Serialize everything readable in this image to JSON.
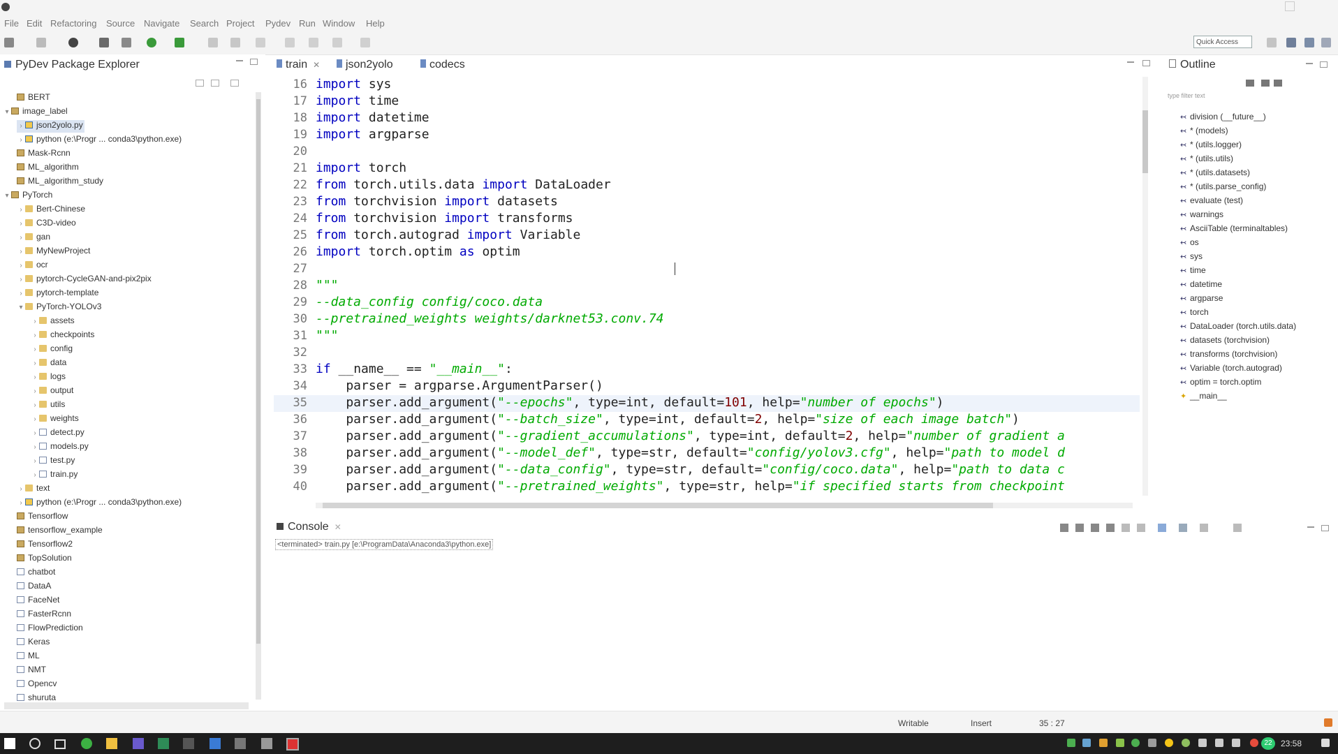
{
  "window": {
    "title": ""
  },
  "menu": [
    "File",
    "Edit",
    "Refactoring",
    "Source",
    "Navigate",
    "Search",
    "Project",
    "Pydev",
    "Run",
    "Window",
    "Help"
  ],
  "toolbar": {
    "quick_access": "Quick Access"
  },
  "explorer": {
    "title": "PyDev Package Explorer",
    "items": [
      {
        "label": "BERT"
      },
      {
        "label": "image_label"
      },
      {
        "label": "json2yolo.py"
      },
      {
        "label": "python (e:\\Progr ... conda3\\python.exe)"
      },
      {
        "label": "Mask-Rcnn"
      },
      {
        "label": "ML_algorithm"
      },
      {
        "label": "ML_algorithm_study"
      },
      {
        "label": "PyTorch"
      },
      {
        "label": "Bert-Chinese"
      },
      {
        "label": "C3D-video"
      },
      {
        "label": "gan"
      },
      {
        "label": "MyNewProject"
      },
      {
        "label": "ocr"
      },
      {
        "label": "pytorch-CycleGAN-and-pix2pix"
      },
      {
        "label": "pytorch-template"
      },
      {
        "label": "PyTorch-YOLOv3"
      },
      {
        "label": "assets"
      },
      {
        "label": "checkpoints"
      },
      {
        "label": "config"
      },
      {
        "label": "data"
      },
      {
        "label": "logs"
      },
      {
        "label": "output"
      },
      {
        "label": "utils"
      },
      {
        "label": "weights"
      },
      {
        "label": "detect.py"
      },
      {
        "label": "models.py"
      },
      {
        "label": "test.py"
      },
      {
        "label": "train.py"
      },
      {
        "label": "text"
      },
      {
        "label": "python (e:\\Progr ... conda3\\python.exe)"
      },
      {
        "label": "Tensorflow"
      },
      {
        "label": "tensorflow_example"
      },
      {
        "label": "Tensorflow2"
      },
      {
        "label": "TopSolution"
      },
      {
        "label": "chatbot"
      },
      {
        "label": "DataA"
      },
      {
        "label": "FaceNet"
      },
      {
        "label": "FasterRcnn"
      },
      {
        "label": "FlowPrediction"
      },
      {
        "label": "Keras"
      },
      {
        "label": "ML"
      },
      {
        "label": "NMT"
      },
      {
        "label": "Opencv"
      },
      {
        "label": "shuruta"
      }
    ]
  },
  "editor": {
    "tabs": [
      "train",
      "json2yolo",
      "codecs"
    ],
    "lines": [
      {
        "n": "16",
        "t": "import sys"
      },
      {
        "n": "17",
        "t": "import time"
      },
      {
        "n": "18",
        "t": "import datetime"
      },
      {
        "n": "19",
        "t": "import argparse"
      },
      {
        "n": "20",
        "t": ""
      },
      {
        "n": "21",
        "t": "import torch"
      },
      {
        "n": "22",
        "t": "from torch.utils.data import DataLoader"
      },
      {
        "n": "23",
        "t": "from torchvision import datasets"
      },
      {
        "n": "24",
        "t": "from torchvision import transforms"
      },
      {
        "n": "25",
        "t": "from torch.autograd import Variable"
      },
      {
        "n": "26",
        "t": "import torch.optim as optim"
      },
      {
        "n": "27",
        "t": ""
      },
      {
        "n": "28",
        "t": "\"\"\""
      },
      {
        "n": "29",
        "t": "--data_config config/coco.data"
      },
      {
        "n": "30",
        "t": "--pretrained_weights weights/darknet53.conv.74"
      },
      {
        "n": "31",
        "t": "\"\"\""
      },
      {
        "n": "32",
        "t": ""
      },
      {
        "n": "33",
        "t": "if __name__ == \"__main__\":"
      },
      {
        "n": "34",
        "t": "    parser = argparse.ArgumentParser()"
      },
      {
        "n": "35",
        "t": "    parser.add_argument(\"--epochs\", type=int, default=101, help=\"number of epochs\")"
      },
      {
        "n": "36",
        "t": "    parser.add_argument(\"--batch_size\", type=int, default=2, help=\"size of each image batch\")"
      },
      {
        "n": "37",
        "t": "    parser.add_argument(\"--gradient_accumulations\", type=int, default=2, help=\"number of gradient a"
      },
      {
        "n": "38",
        "t": "    parser.add_argument(\"--model_def\", type=str, default=\"config/yolov3.cfg\", help=\"path to model d"
      },
      {
        "n": "39",
        "t": "    parser.add_argument(\"--data_config\", type=str, default=\"config/coco.data\", help=\"path to data c"
      },
      {
        "n": "40",
        "t": "    parser.add_argument(\"--pretrained_weights\", type=str, help=\"if specified starts from checkpoint"
      }
    ]
  },
  "outline": {
    "title": "Outline",
    "filter_placeholder": "type filter text",
    "items": [
      "division (__future__)",
      "* (models)",
      "* (utils.logger)",
      "* (utils.utils)",
      "* (utils.datasets)",
      "* (utils.parse_config)",
      "evaluate (test)",
      "warnings",
      "AsciiTable (terminaltables)",
      "os",
      "sys",
      "time",
      "datetime",
      "argparse",
      "torch",
      "DataLoader (torch.utils.data)",
      "datasets (torchvision)",
      "transforms (torchvision)",
      "Variable (torch.autograd)",
      "optim = torch.optim",
      "__main__"
    ]
  },
  "console": {
    "title": "Console",
    "status": "<terminated> train.py [e:\\ProgramData\\Anaconda3\\python.exe]"
  },
  "status": {
    "writable": "Writable",
    "insert": "Insert",
    "position": "35 : 27"
  },
  "taskbar": {
    "time": "23:58",
    "badge": "22"
  }
}
